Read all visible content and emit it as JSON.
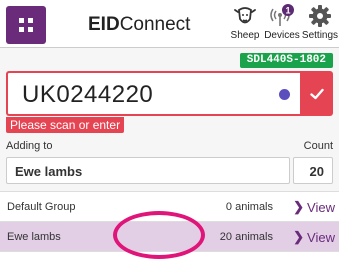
{
  "header": {
    "brand_bold": "EID",
    "brand_rest": "Connect",
    "nav": {
      "sheep": "Sheep",
      "devices": "Devices",
      "settings": "Settings",
      "devices_badge": "1"
    }
  },
  "reader": {
    "device_id": "SDL440S-1802",
    "tag_value": "UK0244220",
    "error": "Please scan or enter"
  },
  "adding": {
    "label": "Adding to",
    "group": "Ewe lambs",
    "count_label": "Count",
    "count": "20"
  },
  "groups": [
    {
      "name": "Default Group",
      "count": "0 animals",
      "action": "View"
    },
    {
      "name": "Ewe lambs",
      "count": "20 animals",
      "action": "View"
    }
  ],
  "colors": {
    "brand": "#6a2b7a",
    "error": "#e54552",
    "device_badge": "#1aa34a",
    "highlight": "#e0157a",
    "selected_row": "#e2cfe6"
  },
  "icons": [
    "grid-menu-icon",
    "sheep-icon",
    "antenna-icon",
    "gear-icon",
    "check-icon",
    "status-dot-icon",
    "chevron-right-icon"
  ]
}
